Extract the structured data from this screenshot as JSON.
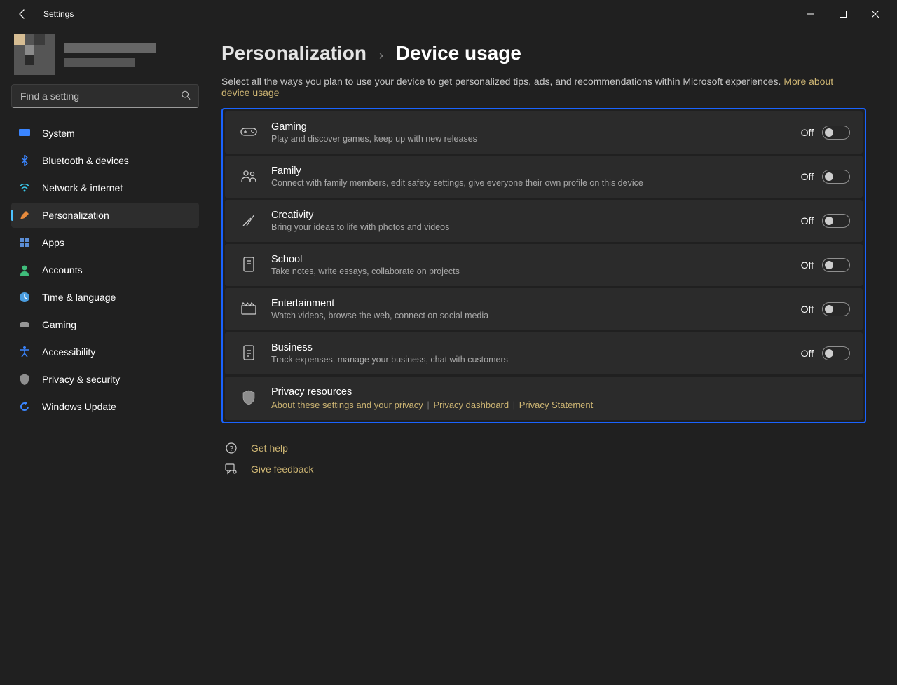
{
  "app": {
    "title": "Settings"
  },
  "search": {
    "placeholder": "Find a setting"
  },
  "sidebar": {
    "items": [
      {
        "label": "System"
      },
      {
        "label": "Bluetooth & devices"
      },
      {
        "label": "Network & internet"
      },
      {
        "label": "Personalization"
      },
      {
        "label": "Apps"
      },
      {
        "label": "Accounts"
      },
      {
        "label": "Time & language"
      },
      {
        "label": "Gaming"
      },
      {
        "label": "Accessibility"
      },
      {
        "label": "Privacy & security"
      },
      {
        "label": "Windows Update"
      }
    ]
  },
  "breadcrumb": {
    "parent": "Personalization",
    "sep": "›",
    "current": "Device usage"
  },
  "desc": {
    "text": "Select all the ways you plan to use your device to get personalized tips, ads, and recommendations within Microsoft experiences. ",
    "more_link": "More about device usage"
  },
  "cards": [
    {
      "title": "Gaming",
      "sub": "Play and discover games, keep up with new releases",
      "state": "Off"
    },
    {
      "title": "Family",
      "sub": "Connect with family members, edit safety settings, give everyone their own profile on this device",
      "state": "Off"
    },
    {
      "title": "Creativity",
      "sub": "Bring your ideas to life with photos and videos",
      "state": "Off"
    },
    {
      "title": "School",
      "sub": "Take notes, write essays, collaborate on projects",
      "state": "Off"
    },
    {
      "title": "Entertainment",
      "sub": "Watch videos, browse the web, connect on social media",
      "state": "Off"
    },
    {
      "title": "Business",
      "sub": "Track expenses, manage your business, chat with customers",
      "state": "Off"
    }
  ],
  "privacy": {
    "title": "Privacy resources",
    "links": [
      "About these settings and your privacy",
      "Privacy dashboard",
      "Privacy Statement"
    ]
  },
  "footer": {
    "help": "Get help",
    "feedback": "Give feedback"
  }
}
